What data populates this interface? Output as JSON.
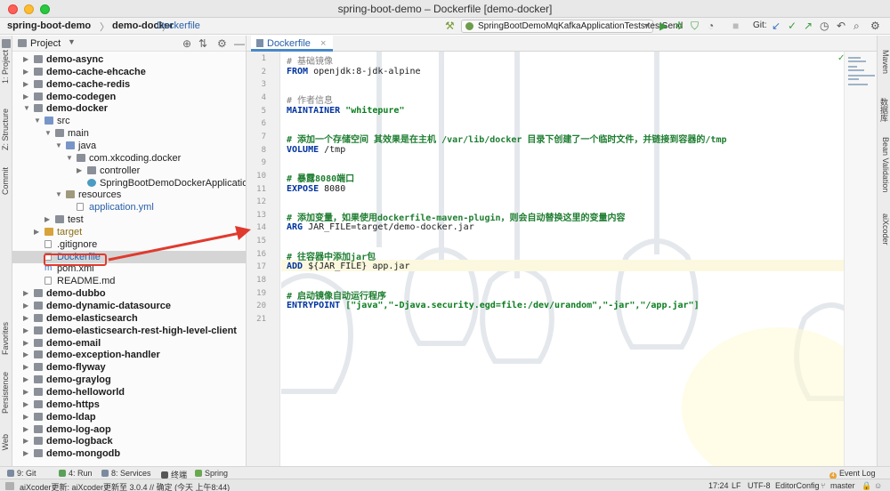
{
  "window": {
    "title": "spring-boot-demo – Dockerfile [demo-docker]"
  },
  "breadcrumb": {
    "root": "spring-boot-demo",
    "module": "demo-docker",
    "file": "Dockerfile",
    "sep": "〉"
  },
  "toolbar": {
    "run_config": "SpringBootDemoMqKafkaApplicationTests.testSend",
    "git_label": "Git:",
    "hammer_icon": "hammer-icon",
    "run_icon": "run-icon",
    "debug_icon": "debug-icon",
    "coverage_icon": "coverage-icon",
    "profile_icon": "profile-icon",
    "stop_icon": "stop-icon",
    "update_icon": "update-icon",
    "commit_icon": "commit-icon",
    "push_icon": "push-icon",
    "history_icon": "history-icon",
    "rollback_icon": "rollback-icon",
    "search_icon": "search-icon",
    "settings_icon": "settings-icon"
  },
  "left_strip": {
    "project": "1: Project",
    "structure": "Z: Structure",
    "commit": "Commit",
    "favorites": "Favorites",
    "persistence": "Persistence",
    "web": "Web"
  },
  "right_strip": {
    "maven": "Maven",
    "database": "数据库",
    "bean_validation": "Bean Validation",
    "aixcoder": "aiXcoder"
  },
  "project_panel": {
    "title": "Project",
    "rows": [
      {
        "label": "demo-async"
      },
      {
        "label": "demo-cache-ehcache"
      },
      {
        "label": "demo-cache-redis"
      },
      {
        "label": "demo-codegen"
      },
      {
        "label": "demo-docker"
      },
      {
        "label": "src"
      },
      {
        "label": "main"
      },
      {
        "label": "java"
      },
      {
        "label": "com.xkcoding.docker"
      },
      {
        "label": "controller"
      },
      {
        "label": "SpringBootDemoDockerApplication"
      },
      {
        "label": "resources"
      },
      {
        "label": "application.yml"
      },
      {
        "label": "test"
      },
      {
        "label": "target"
      },
      {
        "label": ".gitignore"
      },
      {
        "label": "Dockerfile"
      },
      {
        "label": "pom.xml"
      },
      {
        "label": "README.md"
      },
      {
        "label": "demo-dubbo"
      },
      {
        "label": "demo-dynamic-datasource"
      },
      {
        "label": "demo-elasticsearch"
      },
      {
        "label": "demo-elasticsearch-rest-high-level-client"
      },
      {
        "label": "demo-email"
      },
      {
        "label": "demo-exception-handler"
      },
      {
        "label": "demo-flyway"
      },
      {
        "label": "demo-graylog"
      },
      {
        "label": "demo-helloworld"
      },
      {
        "label": "demo-https"
      },
      {
        "label": "demo-ldap"
      },
      {
        "label": "demo-log-aop"
      },
      {
        "label": "demo-logback"
      },
      {
        "label": "demo-mongodb"
      }
    ]
  },
  "editor": {
    "tab": "Dockerfile",
    "tab_close": "×",
    "lines": [
      {
        "n": "1",
        "text": "# 基础镜像"
      },
      {
        "n": "2",
        "kw": "FROM",
        "text": " openjdk:8-jdk-alpine"
      },
      {
        "n": "3",
        "text": ""
      },
      {
        "n": "4",
        "text": "# 作者信息"
      },
      {
        "n": "5",
        "kw": "MAINTAINER",
        "str": " \"whitepure\""
      },
      {
        "n": "6",
        "text": ""
      },
      {
        "n": "7",
        "text": "# 添加一个存储空间 其效果是在主机 /var/lib/docker 目录下创建了一个临时文件，并链接到容器的/tmp"
      },
      {
        "n": "8",
        "kw": "VOLUME",
        "text": " /tmp"
      },
      {
        "n": "9",
        "text": ""
      },
      {
        "n": "10",
        "text": "# 暴露8080端口"
      },
      {
        "n": "11",
        "kw": "EXPOSE",
        "text": " 8080"
      },
      {
        "n": "12",
        "text": ""
      },
      {
        "n": "13",
        "text": "# 添加变量，如果使用dockerfile-maven-plugin，则会自动替换这里的变量内容"
      },
      {
        "n": "14",
        "kw": "ARG",
        "text": " JAR_FILE=target/demo-docker.jar"
      },
      {
        "n": "15",
        "text": ""
      },
      {
        "n": "16",
        "text": "# 往容器中添加jar包"
      },
      {
        "n": "17",
        "kw": "ADD",
        "text": " ${JAR_FILE} app.jar"
      },
      {
        "n": "18",
        "text": ""
      },
      {
        "n": "19",
        "text": "# 启动镜像自动运行程序"
      },
      {
        "n": "20",
        "kw": "ENTRYPOINT",
        "str": " [\"java\",\"-Djava.security.egd=file:/dev/urandom\",\"-jar\",\"/app.jar\"]"
      },
      {
        "n": "21",
        "text": ""
      }
    ]
  },
  "bottom_bar": {
    "git": "9: Git",
    "run": "4: Run",
    "services": "8: Services",
    "terminal": "终端",
    "spring": "Spring",
    "event_log": "Event Log",
    "event_count": "4"
  },
  "status_bar": {
    "message": "aiXcoder更新: aiXcoder更新至 3.0.4 // 确定 (今天 上午8:44)",
    "position": "17:24",
    "line_sep": "LF",
    "encoding": "UTF-8",
    "editor_config": "EditorConfig",
    "branch": "master"
  },
  "annotation": {
    "arrow_color": "#e03a2e",
    "box_color": "#e03a2e"
  }
}
